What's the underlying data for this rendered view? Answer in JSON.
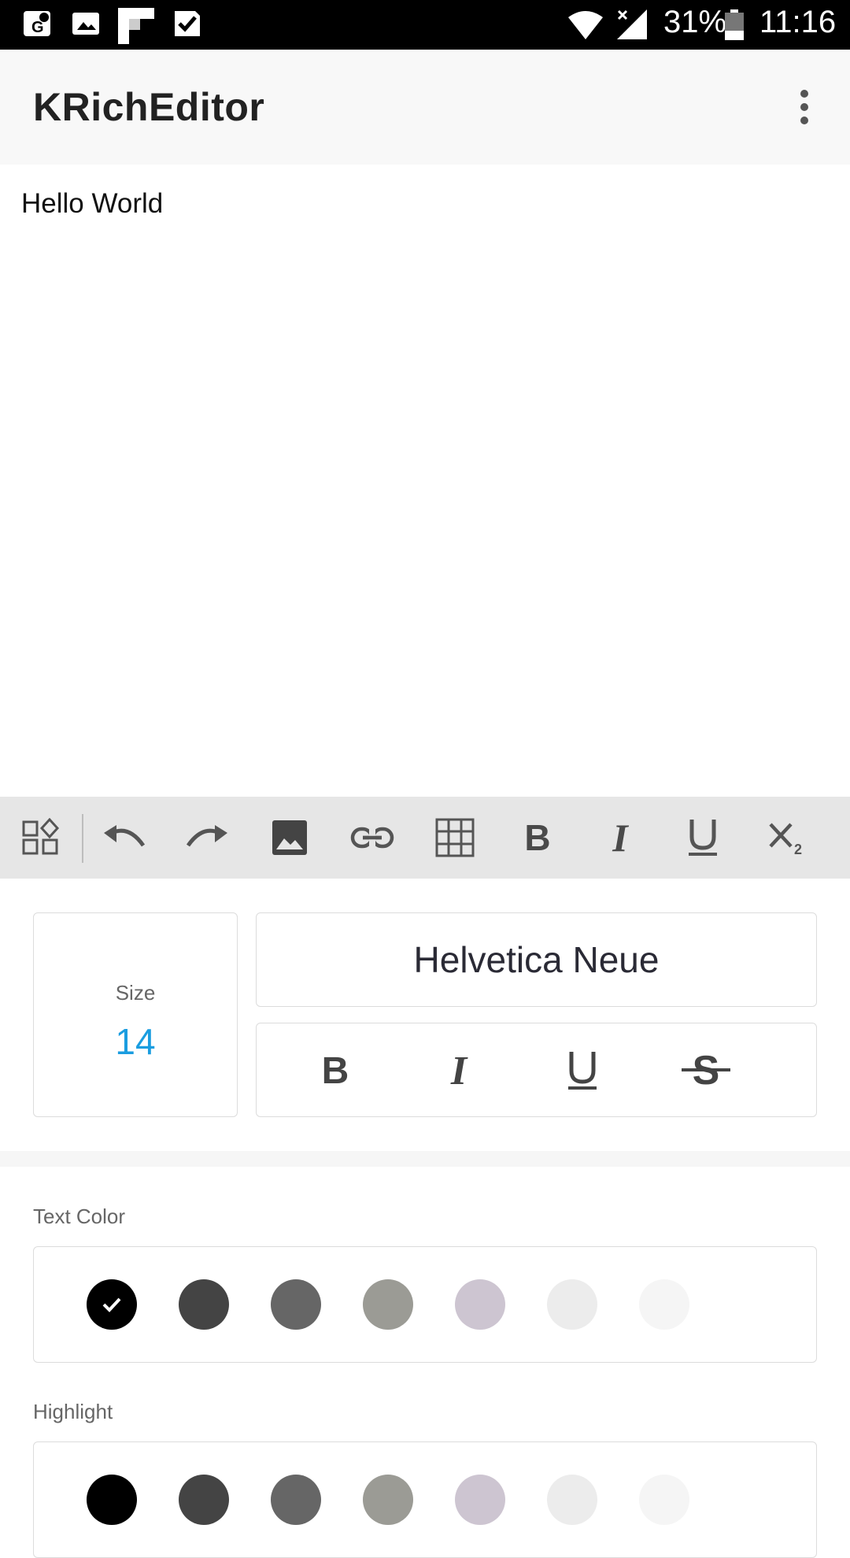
{
  "status_bar": {
    "battery": "31%",
    "time": "11:16"
  },
  "app_bar": {
    "title": "KRichEditor",
    "overflow_icon": "more-vert-icon"
  },
  "editor": {
    "content": "Hello World"
  },
  "toolbar": {
    "items": [
      {
        "name": "widgets-icon"
      },
      {
        "name": "undo-icon"
      },
      {
        "name": "redo-icon"
      },
      {
        "name": "image-icon"
      },
      {
        "name": "link-icon"
      },
      {
        "name": "table-icon"
      },
      {
        "name": "bold-icon"
      },
      {
        "name": "italic-icon"
      },
      {
        "name": "underline-icon"
      },
      {
        "name": "subscript-icon"
      }
    ]
  },
  "panel": {
    "size_label": "Size",
    "size_value": "14",
    "font_name": "Helvetica Neue",
    "styles": [
      "bold-icon",
      "italic-icon",
      "underline-icon",
      "strikethrough-icon"
    ],
    "text_color": {
      "label": "Text Color",
      "colors": [
        "#000000",
        "#444444",
        "#666666",
        "#9b9b95",
        "#cdc5d1",
        "#ececec",
        "#f5f5f5"
      ],
      "selected_index": 0
    },
    "highlight": {
      "label": "Highlight",
      "colors": [
        "#000000",
        "#444444",
        "#666666",
        "#9b9b95",
        "#cdc5d1",
        "#ececec",
        "#f5f5f5"
      ]
    }
  },
  "accent_color": "#1a9de0"
}
